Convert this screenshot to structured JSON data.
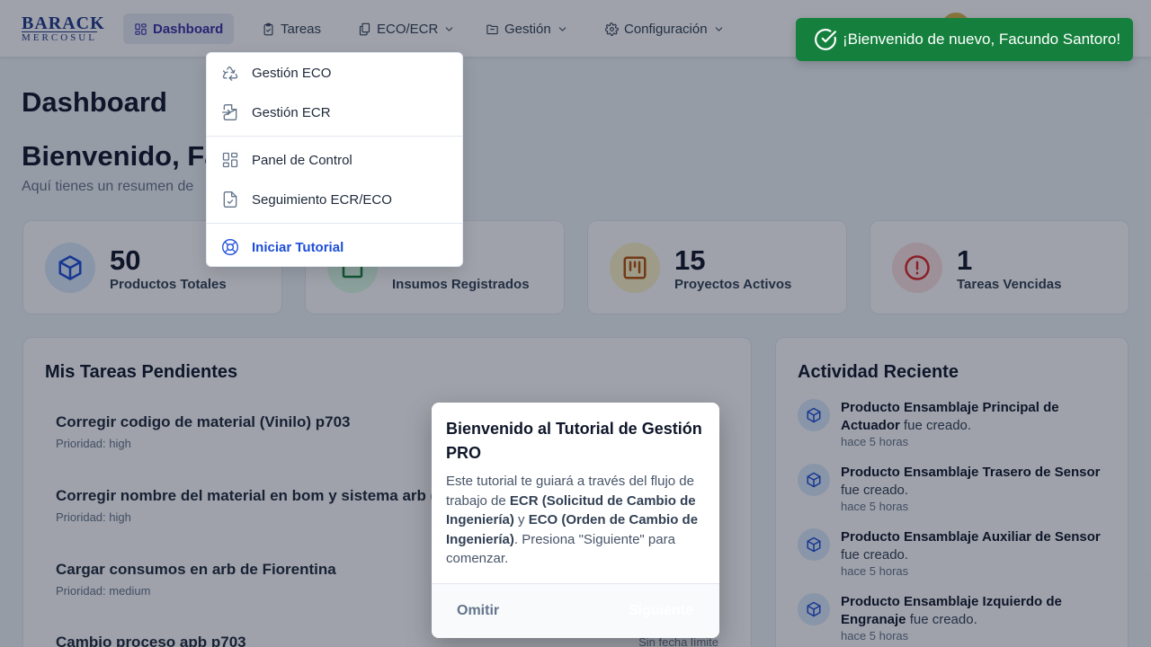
{
  "header": {
    "logo": {
      "line1": "BARACK",
      "line2": "MERCOSUL"
    },
    "nav": [
      {
        "label": "Dashboard",
        "icon": "dashboard-icon"
      },
      {
        "label": "Tareas",
        "icon": "clipboard-check-icon"
      },
      {
        "label": "ECO/ECR",
        "icon": "documents-icon"
      },
      {
        "label": "Gestión",
        "icon": "folder-icon"
      },
      {
        "label": "Configuración",
        "icon": "gear-icon"
      }
    ]
  },
  "dropdown": {
    "items": [
      {
        "label": "Gestión ECO",
        "icon": "recycle-icon"
      },
      {
        "label": "Gestión ECR",
        "icon": "file-import-icon"
      },
      {
        "label": "Panel de Control",
        "icon": "grid-icon"
      },
      {
        "label": "Seguimiento ECR/ECO",
        "icon": "file-check-icon"
      },
      {
        "label": "Iniciar Tutorial",
        "icon": "lifebuoy-icon"
      }
    ]
  },
  "toast": {
    "message": "¡Bienvenido de nuevo, Facundo Santoro!"
  },
  "page": {
    "title": "Dashboard",
    "welcome": "Bienvenido, Fa",
    "subtitle": "Aquí tienes un resumen de"
  },
  "stats": [
    {
      "value": "50",
      "label": "Productos Totales",
      "color": "#1d4ed8",
      "bg": "#dbeafe",
      "icon": "cube-icon"
    },
    {
      "value": "",
      "label": "Insumos Registrados",
      "color": "#15803d",
      "bg": "#dcfce7",
      "icon": "box-icon"
    },
    {
      "value": "15",
      "label": "Proyectos Activos",
      "color": "#b45309",
      "bg": "#fef3c7",
      "icon": "kanban-icon"
    },
    {
      "value": "1",
      "label": "Tareas Vencidas",
      "color": "#dc2626",
      "bg": "#fee2e2",
      "icon": "alert-circle-icon"
    }
  ],
  "tasks": {
    "title": "Mis Tareas Pendientes",
    "items": [
      {
        "title": "Corregir codigo de material (Vinilo) p703",
        "priority": "Prioridad: high",
        "due": ""
      },
      {
        "title": "Corregir nombre del material en bom y sistema arb (Co",
        "priority": "Prioridad: high",
        "due": ""
      },
      {
        "title": "Cargar consumos en arb de Fiorentina",
        "priority": "Prioridad: medium",
        "due": ""
      },
      {
        "title": "Cambio proceso apb p703",
        "priority": "",
        "due": "Sin fecha límite"
      }
    ]
  },
  "activity": {
    "title": "Actividad Reciente",
    "items": [
      {
        "type": "Producto",
        "name": "Ensamblaje Principal de Actuador",
        "action": "fue creado.",
        "time": "hace 5 horas"
      },
      {
        "type": "Producto",
        "name": "Ensamblaje Trasero de Sensor",
        "action": "fue creado.",
        "time": "hace 5 horas"
      },
      {
        "type": "Producto",
        "name": "Ensamblaje Auxiliar de Sensor",
        "action": "fue creado.",
        "time": "hace 5 horas"
      },
      {
        "type": "Producto",
        "name": "Ensamblaje Izquierdo de Engranaje",
        "action": "fue creado.",
        "time": "hace 5 horas"
      }
    ]
  },
  "modal": {
    "title": "Bienvenido al Tutorial de Gestión PRO",
    "body_1": "Este tutorial te guiará a través del flujo de trabajo de ",
    "ecr": "ECR (Solicitud de Cambio de Ingeniería)",
    "body_2": " y ",
    "eco": "ECO (Orden de Cambio de Ingeniería)",
    "body_3": ". Presiona \"Siguiente\" para comenzar.",
    "skip_label": "Omitir",
    "next_label": "Siguiente"
  }
}
